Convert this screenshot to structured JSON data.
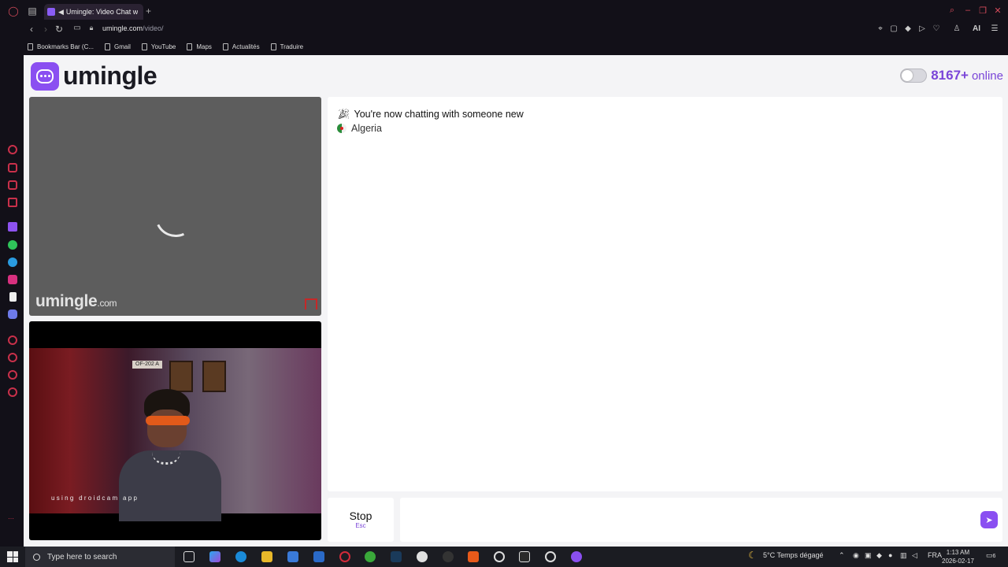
{
  "browser": {
    "tab": {
      "title": "Umingle: Video Chat w"
    },
    "new_tab_symbol": "+",
    "url": {
      "host": "umingle.com",
      "path": "/video/"
    },
    "ai_label": "AI",
    "bookmarks": [
      "Bookmarks Bar (C...",
      "Gmail",
      "YouTube",
      "Maps",
      "Actualités",
      "Traduire"
    ]
  },
  "app": {
    "logo_text": "umingle",
    "online": {
      "count": "8167+",
      "label": "online",
      "toggle_on": false
    },
    "stranger": {
      "watermark": "umingle",
      "watermark_suffix": ".com"
    },
    "self": {
      "caption": "using droidcam app",
      "plate": "OF-202 A"
    },
    "chat": {
      "status": "You're now chatting with someone new",
      "country": "Algeria"
    },
    "stop": {
      "label": "Stop",
      "shortcut": "Esc"
    },
    "input": {
      "value": "",
      "placeholder": ""
    }
  },
  "taskbar": {
    "search_placeholder": "Type here to search",
    "weather": "5°C  Temps dégagé",
    "language": "FRA",
    "time": "1:13 AM",
    "date": "2026-02-17",
    "notifications": "6"
  },
  "colors": {
    "accent": "#8a4ff1",
    "online_text": "#7a45d8",
    "browser_bg": "#121018",
    "page_bg": "#f4f4f6"
  }
}
